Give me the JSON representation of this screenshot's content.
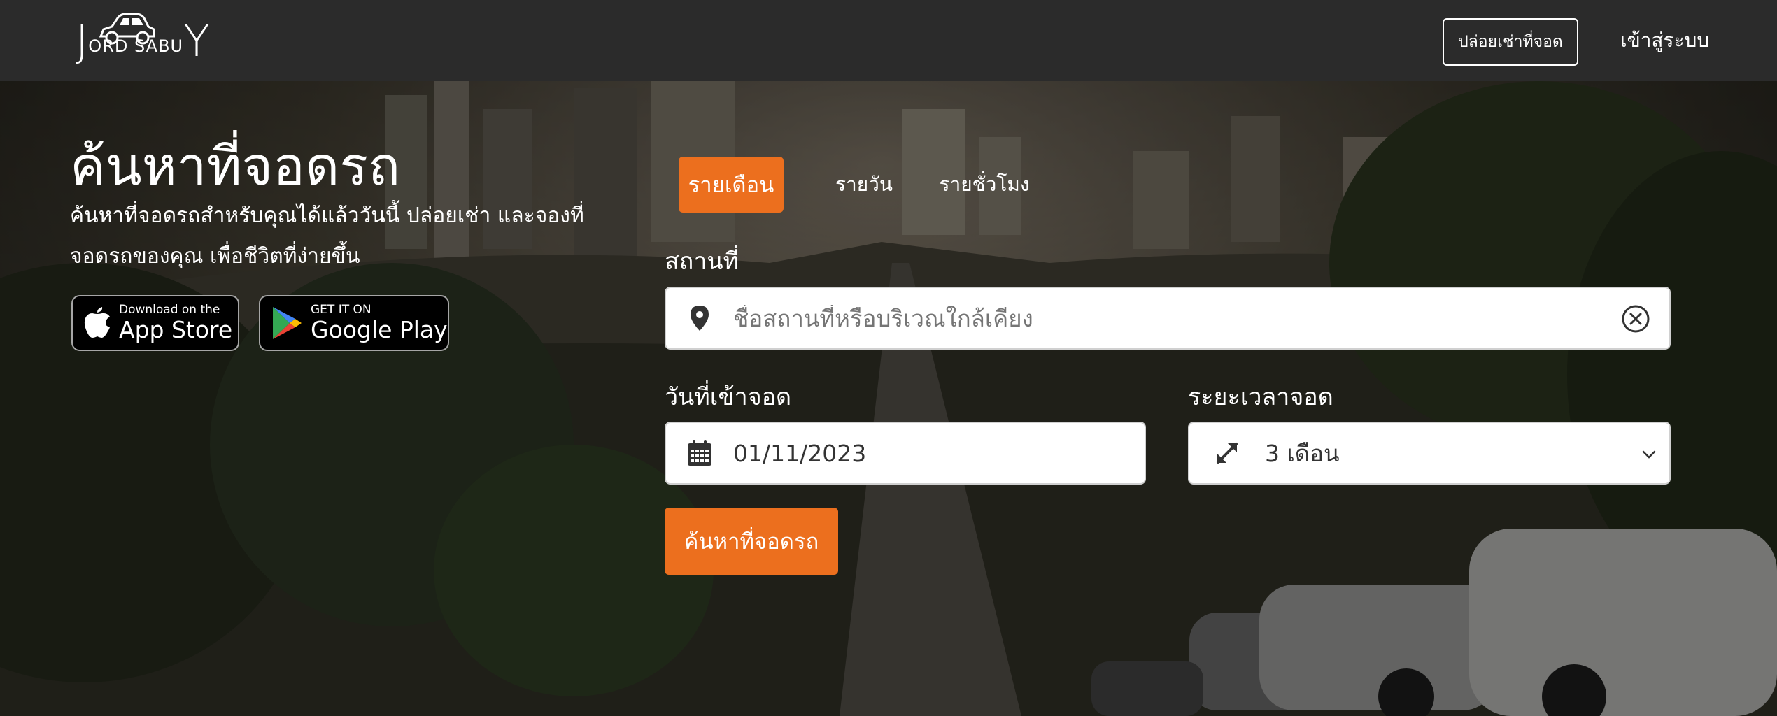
{
  "header": {
    "logo_text": "JORD SABUY",
    "logo_first": "J",
    "logo_mid": "ORD SABU",
    "logo_last": "Y",
    "list_space_button": "ปล่อยเช่าที่จอด",
    "login_link": "เข้าสู่ระบบ"
  },
  "hero": {
    "title": "ค้นหาที่จอดรถ",
    "subtitle": "ค้นหาที่จอดรถสำหรับคุณได้แล้ววันนี้ ปล่อยเช่า และจองที่จอดรถของคุณ เพื่อชีวิตที่ง่ายขึ้น",
    "app_store": {
      "small": "Download on the",
      "big": "App Store"
    },
    "google_play": {
      "small": "GET IT ON",
      "big": "Google Play"
    }
  },
  "search": {
    "tabs": [
      {
        "label": "รายเดือน",
        "active": true
      },
      {
        "label": "รายวัน",
        "active": false
      },
      {
        "label": "รายชั่วโมง",
        "active": false
      }
    ],
    "location_label": "สถานที่",
    "location_placeholder": "ชื่อสถานที่หรือบริเวณใกล้เคียง",
    "date_label": "วันที่เข้าจอด",
    "date_value": "01/11/2023",
    "duration_label": "ระยะเวลาจอด",
    "duration_value": "3 เดือน",
    "submit_label": "ค้นหาที่จอดรถ"
  },
  "colors": {
    "accent": "#ec6f1e",
    "header_bg": "#2b2b2b"
  },
  "icons": [
    "car-icon",
    "apple-icon",
    "google-play-icon",
    "map-pin-icon",
    "clear-circle-icon",
    "calendar-icon",
    "expand-arrows-icon",
    "chevron-down-icon"
  ]
}
